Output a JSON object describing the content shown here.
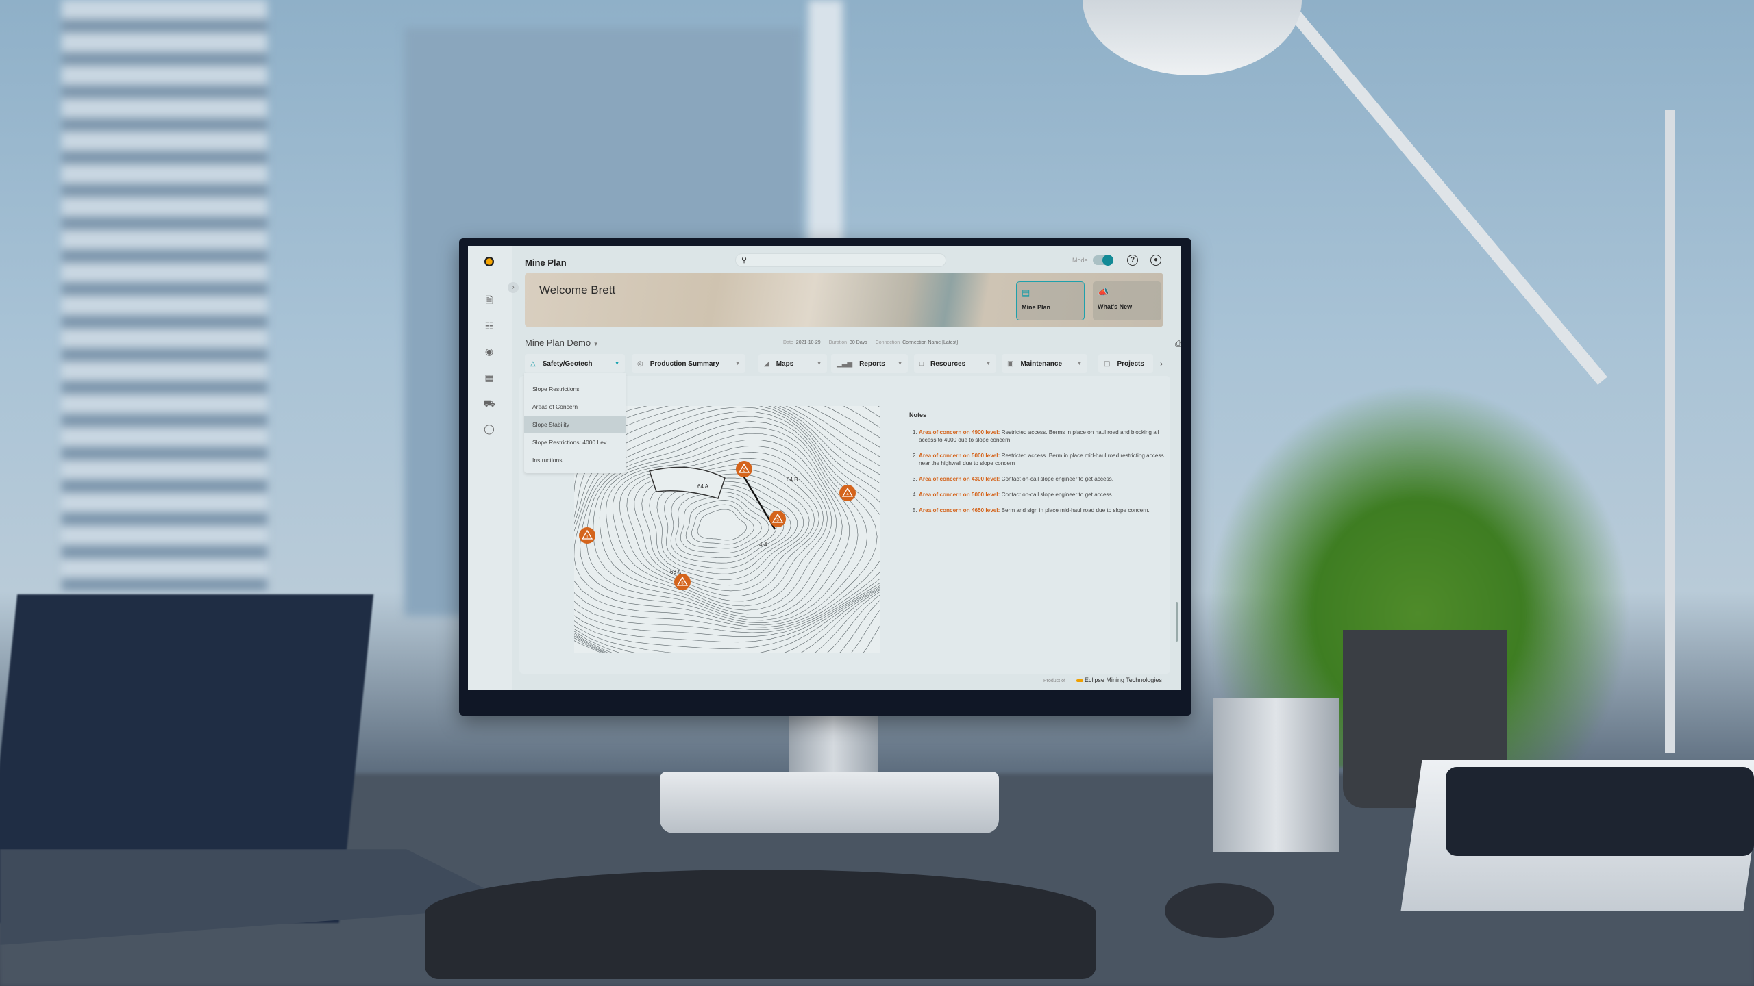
{
  "app": {
    "title": "Mine Plan",
    "search_icon": "search-icon",
    "mode_label": "Mode",
    "mode_on": true,
    "help_icon": "help-icon",
    "profile_icon": "user-circle-icon",
    "accent": "#138a96",
    "concern_color": "#d4641c"
  },
  "sidebar": {
    "expand_icon": "chevron-right-icon",
    "items": [
      {
        "icon": "document-search-icon"
      },
      {
        "icon": "hierarchy-icon"
      },
      {
        "icon": "ore-icon"
      },
      {
        "icon": "mine-map-icon"
      },
      {
        "icon": "haul-truck-icon"
      },
      {
        "icon": "lightbulb-icon"
      }
    ]
  },
  "banner": {
    "welcome": "Welcome Brett",
    "cards": [
      {
        "label": "Mine Plan",
        "icon": "document-icon",
        "active": true
      },
      {
        "label": "What's New",
        "icon": "megaphone-icon",
        "active": false
      }
    ]
  },
  "project": {
    "name": "Mine Plan Demo",
    "date_label": "Date",
    "date": "2021-10-29",
    "duration_label": "Duration",
    "duration": "30 Days",
    "connection_label": "Connection",
    "connection": "Connection Name [Latest]",
    "print_icon": "printer-icon"
  },
  "tabs": [
    {
      "label": "Safety/Geotech",
      "icon": "warning-icon",
      "open": true
    },
    {
      "label": "Production Summary",
      "icon": "target-icon"
    },
    {
      "label": "Maps",
      "icon": "map-icon"
    },
    {
      "label": "Reports",
      "icon": "bar-chart-icon"
    },
    {
      "label": "Resources",
      "icon": "file-icon"
    },
    {
      "label": "Maintenance",
      "icon": "calendar-icon"
    },
    {
      "label": "Projects",
      "icon": "projects-icon"
    }
  ],
  "dropdown": {
    "items": [
      {
        "label": "Slope Restrictions"
      },
      {
        "label": "Areas of Concern"
      },
      {
        "label": "Slope Stability",
        "selected": true
      },
      {
        "label": "Slope Restrictions: 4000 Lev..."
      },
      {
        "label": "Instructions"
      }
    ]
  },
  "map": {
    "markers": [
      "1",
      "2",
      "3",
      "4",
      "5"
    ],
    "labels": [
      "64 A",
      "64 B",
      "63 A",
      "4-4"
    ]
  },
  "notes": {
    "title": "Notes",
    "items": [
      {
        "key": "Area of concern on 4900 level:",
        "text": " Restricted access. Berms in place on haul road and blocking all access to 4900 due to slope concern."
      },
      {
        "key": "Area of concern on 5000 level:",
        "text": " Restricted access. Berm in place mid-haul road restricting access near the highwall due to slope concern"
      },
      {
        "key": "Area of concern on 4300 level:",
        "text": " Contact on-call slope engineer to get access."
      },
      {
        "key": "Area of concern on 5000 level:",
        "text": " Contact on-call slope engineer to get access."
      },
      {
        "key": "Area of concern on 4650 level:",
        "text": " Berm and sign in place mid-haul road due to slope concern."
      }
    ]
  },
  "footer": {
    "product_of": "Product of",
    "brand": "Eclipse Mining Technologies"
  }
}
